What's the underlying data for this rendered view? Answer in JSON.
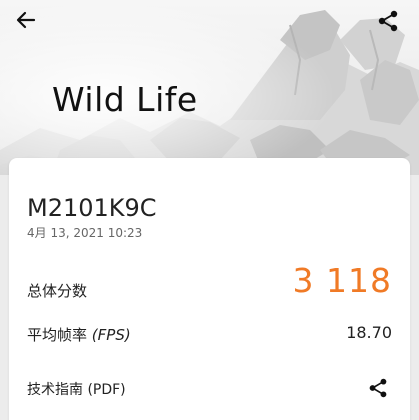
{
  "header": {
    "title": "Wild Life",
    "back_icon": "arrow-left-icon",
    "share_icon": "share-icon"
  },
  "result": {
    "device": "M2101K9C",
    "timestamp": "4月 13, 2021 10:23",
    "score_label": "总体分数",
    "score_value": "3 118",
    "fps_label_prefix": "平均帧率",
    "fps_label_em": "(FPS)",
    "fps_value": "18.70",
    "guide_label": "技术指南 (PDF)"
  },
  "colors": {
    "accent": "#f07a26",
    "text": "#222222",
    "muted": "#666666",
    "card": "#ffffff",
    "background": "#ececec"
  }
}
